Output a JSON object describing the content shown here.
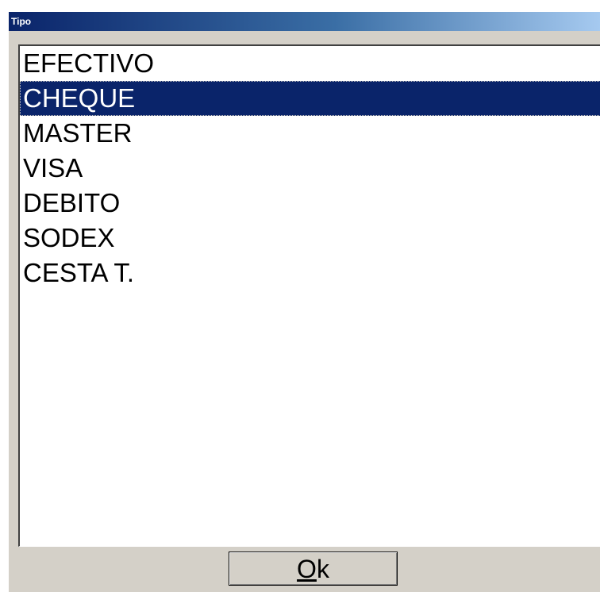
{
  "window": {
    "title": "Tipo"
  },
  "list": {
    "selected_index": 1,
    "items": [
      {
        "label": "EFECTIVO"
      },
      {
        "label": "CHEQUE"
      },
      {
        "label": "MASTER"
      },
      {
        "label": "VISA"
      },
      {
        "label": "DEBITO"
      },
      {
        "label": "SODEX"
      },
      {
        "label": "CESTA T."
      }
    ]
  },
  "ok_button": {
    "mnemonic": "O",
    "rest": "k"
  },
  "colors": {
    "selection": "#0a246a",
    "titlebar_start": "#0a246a",
    "titlebar_end": "#a6caf0",
    "face": "#d4d0c8"
  }
}
